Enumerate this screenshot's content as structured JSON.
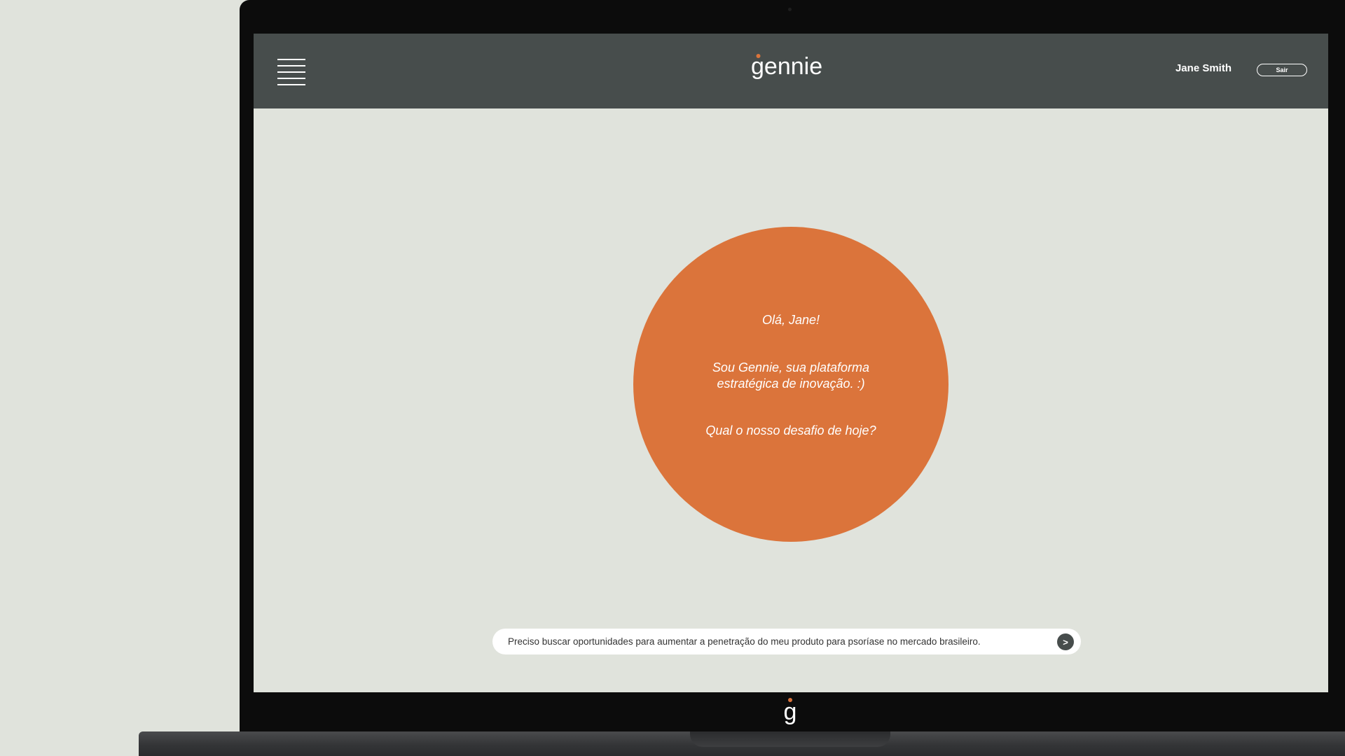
{
  "app": {
    "logo_text": "gennie",
    "bezel_logo_text": "g"
  },
  "header": {
    "user_name": "Jane Smith",
    "logout_label": "Sair"
  },
  "greeting": {
    "line1": "Olá, Jane!",
    "line2": "Sou Gennie, sua plataforma estratégica de inovação. :)",
    "line3": "Qual o nosso desafio de hoje?"
  },
  "chat": {
    "input_value": "Preciso buscar oportunidades para aumentar a penetração do meu produto para psoríase no mercado brasileiro.",
    "send_label": ">"
  },
  "icons": {
    "menu": "hamburger-menu-icon",
    "send": "send-arrow-icon",
    "logo": "gennie-logo"
  },
  "colors": {
    "accent": "#db743b",
    "header": "#474d4c",
    "background": "#e0e3dc"
  }
}
